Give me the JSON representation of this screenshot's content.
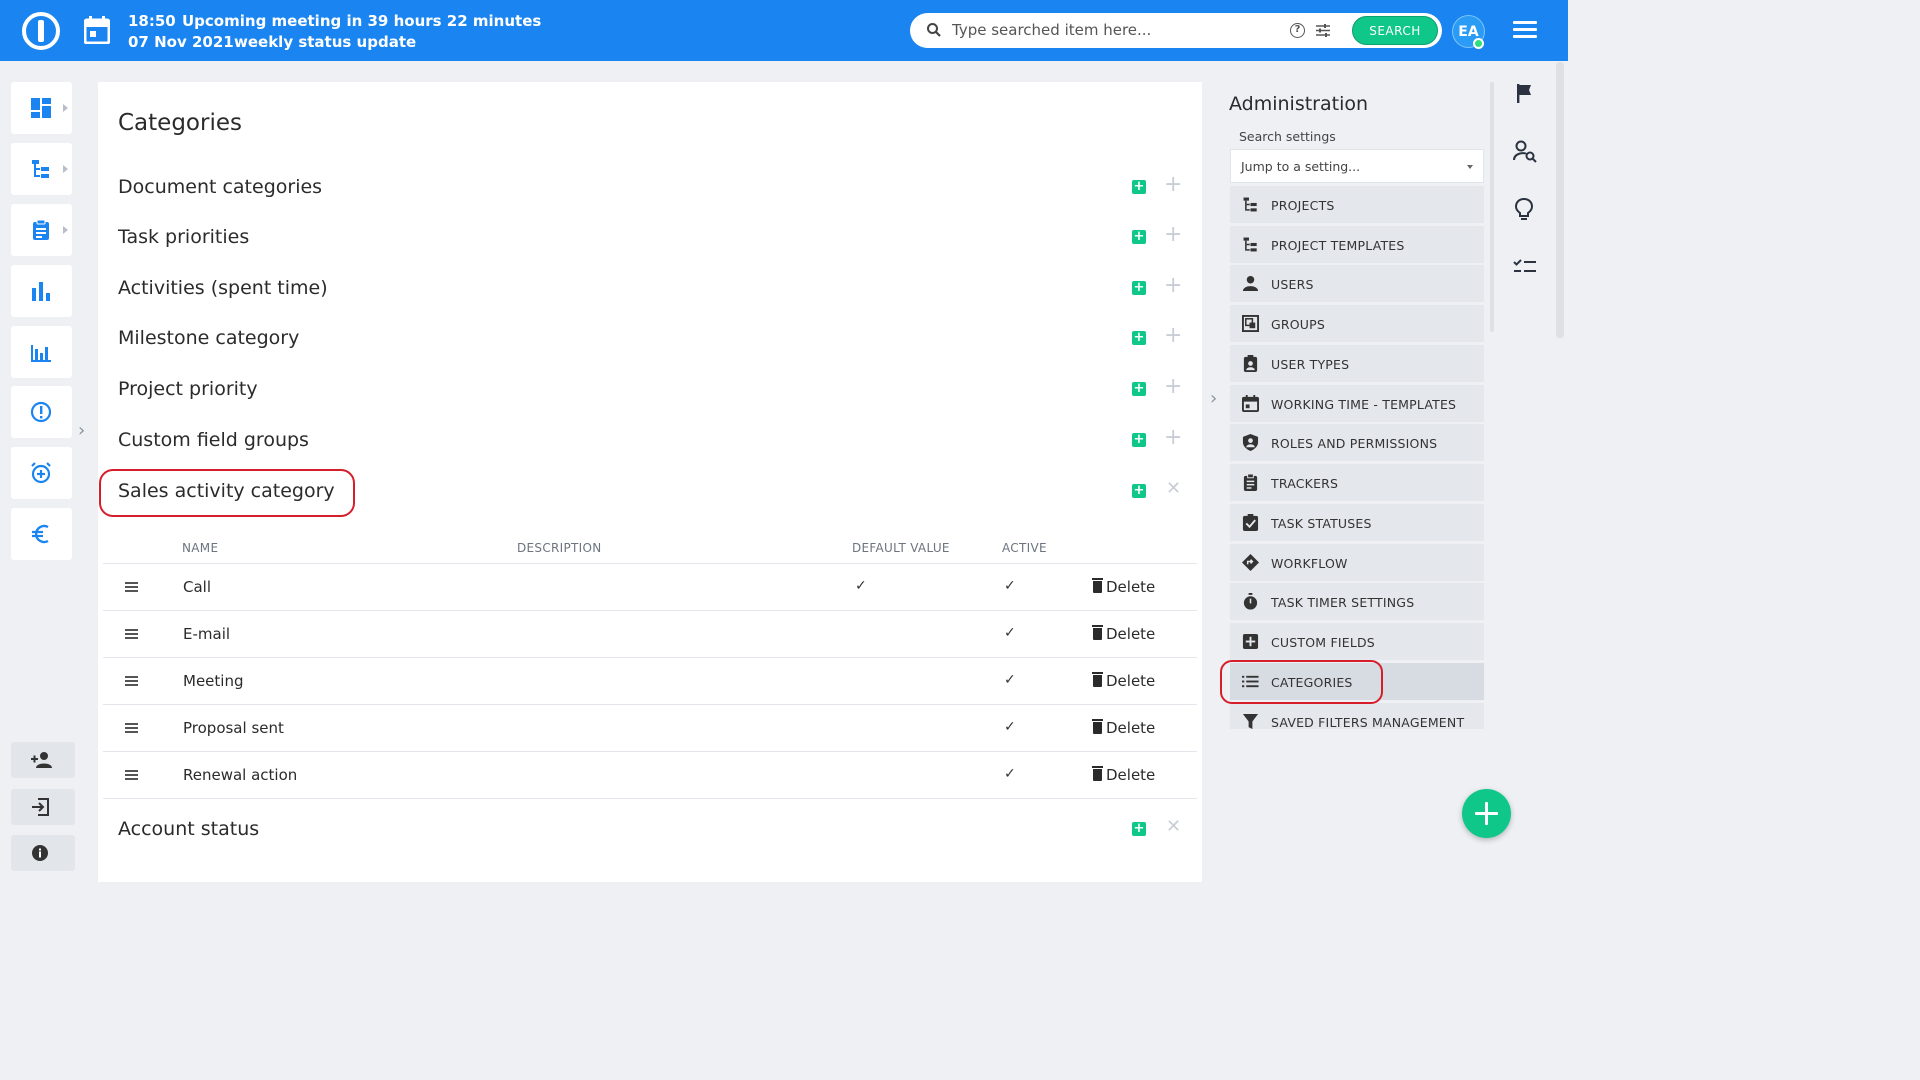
{
  "topbar": {
    "time": "18:50",
    "date": "07 Nov 2021",
    "meeting_title": "Upcoming meeting in 39 hours 22 minutes",
    "meeting_name": "weekly status update",
    "search_placeholder": "Type searched item here...",
    "search_button": "SEARCH",
    "avatar_initials": "EA"
  },
  "left_sidebar": {
    "icons": [
      "dashboard-icon",
      "project-tree-icon",
      "tasks-icon",
      "bar-chart-icon",
      "reports-icon",
      "alert-icon",
      "alarm-icon",
      "euro-icon"
    ],
    "bottom_icons": [
      "add-user-icon",
      "login-icon",
      "info-icon"
    ]
  },
  "main": {
    "title": "Categories",
    "categories": [
      "Document categories",
      "Task priorities",
      "Activities (spent time)",
      "Milestone category",
      "Project priority",
      "Custom field groups",
      "Sales activity category"
    ],
    "table": {
      "headers": {
        "name": "NAME",
        "description": "DESCRIPTION",
        "default_value": "DEFAULT VALUE",
        "active": "ACTIVE"
      },
      "rows": [
        {
          "name": "Call",
          "default": true,
          "active": true
        },
        {
          "name": "E-mail",
          "default": false,
          "active": true
        },
        {
          "name": "Meeting",
          "default": false,
          "active": true
        },
        {
          "name": "Proposal sent",
          "default": false,
          "active": true
        },
        {
          "name": "Renewal action",
          "default": false,
          "active": true
        }
      ],
      "delete_label": "Delete",
      "check_glyph": "✓"
    },
    "next_category": "Account status"
  },
  "admin": {
    "title": "Administration",
    "search_label": "Search settings",
    "select_placeholder": "Jump to a setting...",
    "items": [
      {
        "label": "PROJECTS",
        "icon": "project-tree-icon"
      },
      {
        "label": "PROJECT TEMPLATES",
        "icon": "project-tree-icon"
      },
      {
        "label": "USERS",
        "icon": "user-icon"
      },
      {
        "label": "GROUPS",
        "icon": "groups-icon"
      },
      {
        "label": "USER TYPES",
        "icon": "user-badge-icon"
      },
      {
        "label": "WORKING TIME - TEMPLATES",
        "icon": "calendar-icon"
      },
      {
        "label": "ROLES AND PERMISSIONS",
        "icon": "shield-user-icon"
      },
      {
        "label": "TRACKERS",
        "icon": "clipboard-icon"
      },
      {
        "label": "TASK STATUSES",
        "icon": "checkbox-icon"
      },
      {
        "label": "WORKFLOW",
        "icon": "workflow-diamond-icon"
      },
      {
        "label": "TASK TIMER SETTINGS",
        "icon": "stopwatch-icon"
      },
      {
        "label": "CUSTOM FIELDS",
        "icon": "plus-box-icon"
      },
      {
        "label": "CATEGORIES",
        "icon": "list-icon",
        "active": true
      },
      {
        "label": "SAVED FILTERS MANAGEMENT",
        "icon": "filter-icon"
      }
    ]
  },
  "right_rail": {
    "icons": [
      "flag-icon",
      "user-search-icon",
      "lightbulb-icon",
      "checklist-icon"
    ]
  },
  "colors": {
    "topbar": "#1a85f0",
    "accent_green": "#10c78a",
    "highlight_red": "#d51e2a"
  }
}
